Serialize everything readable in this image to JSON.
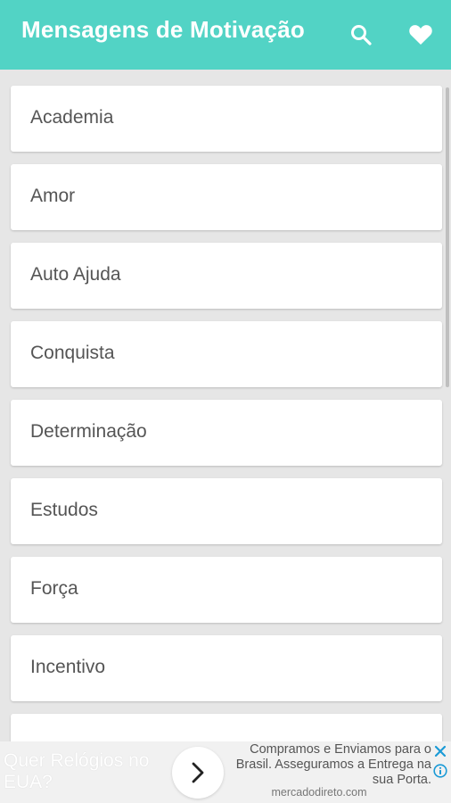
{
  "app": {
    "title": "Mensagens de Motivação",
    "accent_color": "#52d3c5",
    "toolbar_icons": [
      "search-icon",
      "heart-icon"
    ]
  },
  "categories": [
    {
      "label": "Academia"
    },
    {
      "label": "Amor"
    },
    {
      "label": "Auto Ajuda"
    },
    {
      "label": "Conquista"
    },
    {
      "label": "Determinação"
    },
    {
      "label": "Estudos"
    },
    {
      "label": "Força"
    },
    {
      "label": "Incentivo"
    },
    {
      "label": ""
    }
  ],
  "ad": {
    "headline": "Quer Relógios no EUA?",
    "body": "Compramos e Enviamos para o Brasil. Asseguramos a Entrega na sua Porta.",
    "domain": "mercadodireto.com",
    "icons": [
      "chevron-right-icon",
      "close-icon",
      "info-icon"
    ]
  }
}
